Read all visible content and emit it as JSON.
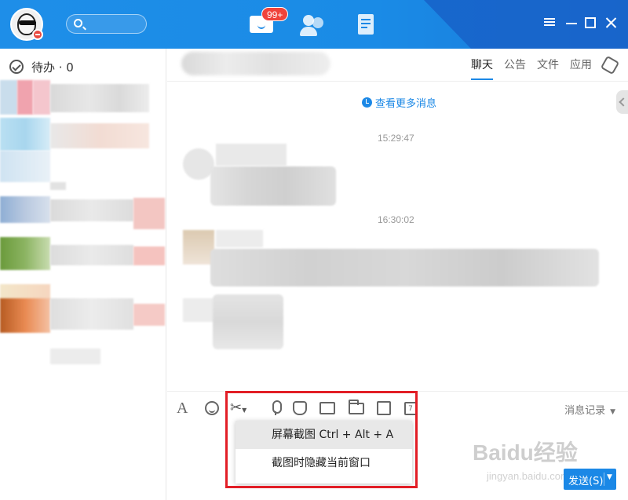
{
  "header": {
    "badge": "99+",
    "accent": "#1b88e6"
  },
  "sidebar": {
    "todo_label": "待办 · 0"
  },
  "chat": {
    "tabs": [
      "聊天",
      "公告",
      "文件",
      "应用"
    ],
    "active_tab": "聊天",
    "more_messages": "查看更多消息",
    "timestamps": [
      "15:29:47",
      "16:30:02"
    ]
  },
  "toolbar": {
    "history_label": "消息记录",
    "history_caret": "▼",
    "cal_day": "7"
  },
  "screenshot_menu": {
    "items": [
      "屏幕截图 Ctrl + Alt + A",
      "截图时隐藏当前窗口"
    ]
  },
  "send": {
    "label": "发送(S)",
    "caret": "▼"
  },
  "watermark": {
    "brand": "Baidu经验",
    "url": "jingyan.baidu.com"
  }
}
